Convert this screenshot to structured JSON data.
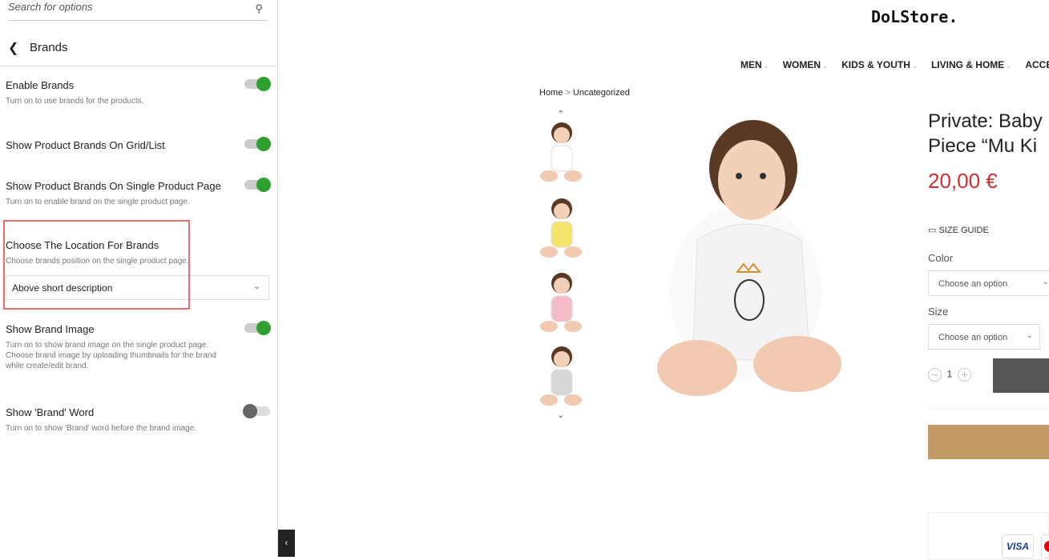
{
  "sidebar": {
    "search_placeholder": "Search for options",
    "section_title": "Brands",
    "options": [
      {
        "label": "Enable Brands",
        "desc": "Turn on to use brands for the products.",
        "on": true
      },
      {
        "label": "Show Product Brands On Grid/List",
        "desc": "",
        "on": true
      },
      {
        "label": "Show Product Brands On Single Product Page",
        "desc": "Turn on to enable brand on the single product page.",
        "on": true
      },
      {
        "label": "Choose The Location For Brands",
        "desc": "Choose brands position on the single product page.",
        "value": "Above short description"
      },
      {
        "label": "Show Brand Image",
        "desc": "Turn on to show brand image on the single product page. Choose brand image by uploading thumbnails for the brand while create/edit brand.",
        "on": true
      },
      {
        "label": "Show 'Brand' Word",
        "desc": "Turn on to show 'Brand' word before the brand image.",
        "on": false
      }
    ],
    "toggle_on_color": "#2ea02e",
    "highlight_color": "#f06a6a"
  },
  "store": {
    "logo": "DoLStore.",
    "nav": [
      "MEN",
      "WOMEN",
      "KIDS & YOUTH",
      "LIVING & HOME",
      "ACCE"
    ],
    "breadcrumb": {
      "home": "Home",
      "sep": ">",
      "current": "Uncategorized"
    },
    "product": {
      "title_line1": "Private: Baby",
      "title_line2": "Piece “Mu Ki",
      "price": "20,00 €",
      "size_guide": "SIZE GUIDE",
      "color_label": "Color",
      "color_placeholder": "Choose an option",
      "size_label": "Size",
      "size_placeholder": "Choose an option",
      "quantity": "1",
      "payment": "VISA"
    },
    "thumb_colors": [
      "#ffffff",
      "#f5e56b",
      "#f4bcc8",
      "#d8d8d8"
    ]
  }
}
